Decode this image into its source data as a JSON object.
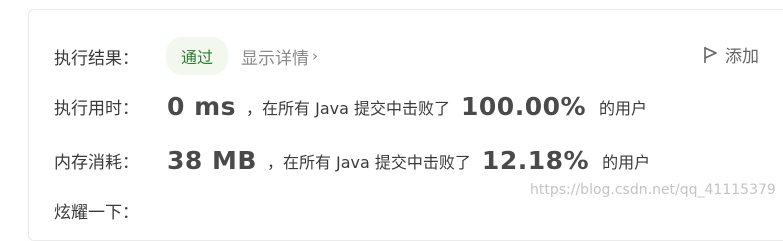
{
  "result": {
    "label": "执行结果：",
    "status": "通过",
    "details_link": "显示详情",
    "details_chevron": "›",
    "add_note": "添加"
  },
  "runtime": {
    "label": "执行用时：",
    "value": "0 ms",
    "prefix": "，在所有 Java 提交中击败了",
    "percent": "100.00%",
    "suffix": "的用户"
  },
  "memory": {
    "label": "内存消耗：",
    "value": "38 MB",
    "prefix": "，在所有 Java 提交中击败了",
    "percent": "12.18%",
    "suffix": "的用户"
  },
  "cut_off_label": "炫耀一下：",
  "watermark": "https://blog.csdn.net/qq_41115379",
  "icons": {
    "flag": "flag-icon",
    "chevron": "chevron-right-icon"
  },
  "colors": {
    "status_bg": "#f2f8ee",
    "status_text": "#2e7d32",
    "label_text": "#3a3a3a",
    "muted_text": "#8a8a8a"
  }
}
